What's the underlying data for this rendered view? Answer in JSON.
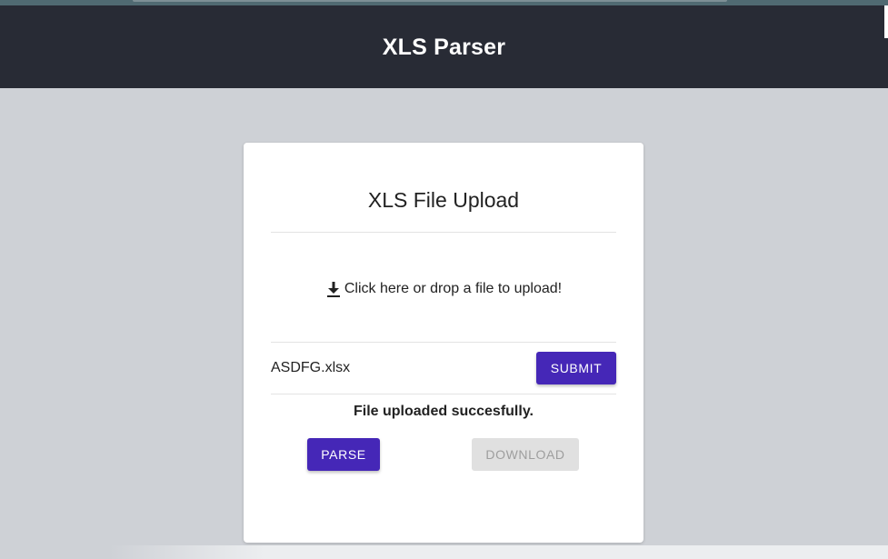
{
  "header": {
    "title": "XLS Parser"
  },
  "upload_card": {
    "title": "XLS File Upload",
    "dropzone": {
      "icon": "download-icon",
      "label": "Click here or drop a file to upload!"
    },
    "file": {
      "name": "ASDFG.xlsx"
    },
    "submit_label": "SUBMIT",
    "status_message": "File uploaded succesfully.",
    "parse_label": "PARSE",
    "download_label": "DOWNLOAD"
  },
  "colors": {
    "header_bg": "#282b35",
    "page_bg": "#ced1d6",
    "primary_button": "#4527b7",
    "disabled_button": "#e0e0e0"
  }
}
